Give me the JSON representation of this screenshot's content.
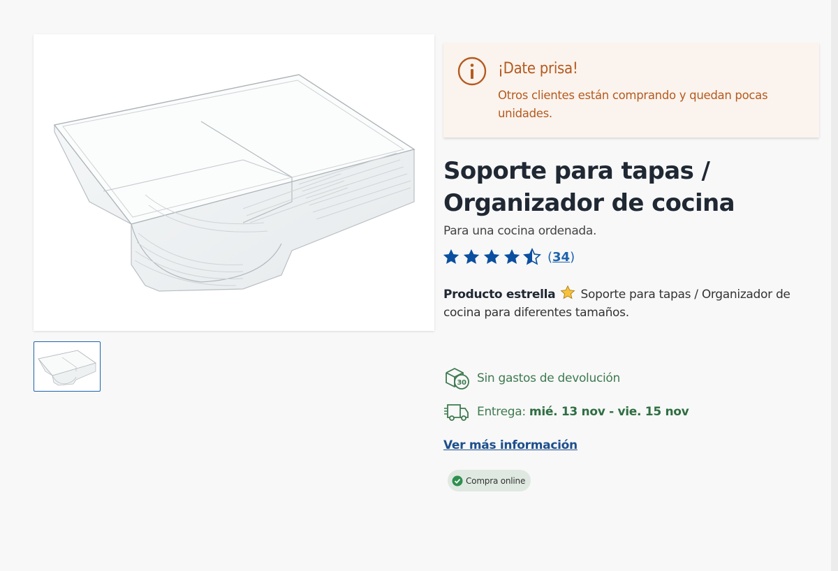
{
  "gallery": {
    "main_image_alt": "Soporte para tapas / Organizador de cocina",
    "thumbnail_count": 1
  },
  "alert": {
    "title": "¡Date prisa!",
    "message": "Otros clientes están comprando y quedan pocas unidades.",
    "icon": "info-icon",
    "color": "#b45a1f"
  },
  "product": {
    "title": "Soporte para tapas / Organizador de cocina",
    "subtitle": "Para una cocina ordenada.",
    "rating": {
      "value": 4.5,
      "max": 5,
      "review_count": "34"
    },
    "description_label": "Producto estrella",
    "description_text": "Soporte para tapas / Organizador de cocina para diferentes tamaños."
  },
  "features": {
    "returns_label": "Sin gastos de devolución",
    "returns_icon": "box-30-days-icon",
    "delivery_label": "Entrega:",
    "delivery_dates": "mié. 13 nov - vie. 15 nov",
    "delivery_icon": "truck-icon"
  },
  "links": {
    "more_info": "Ver más información"
  },
  "badge": {
    "label": "Compra online",
    "icon": "check-circle-icon"
  },
  "colors": {
    "accent": "#1d62ad",
    "star": "#0a4fa0",
    "success": "#3e7a4f",
    "alert_bg": "#fbf3ed"
  }
}
